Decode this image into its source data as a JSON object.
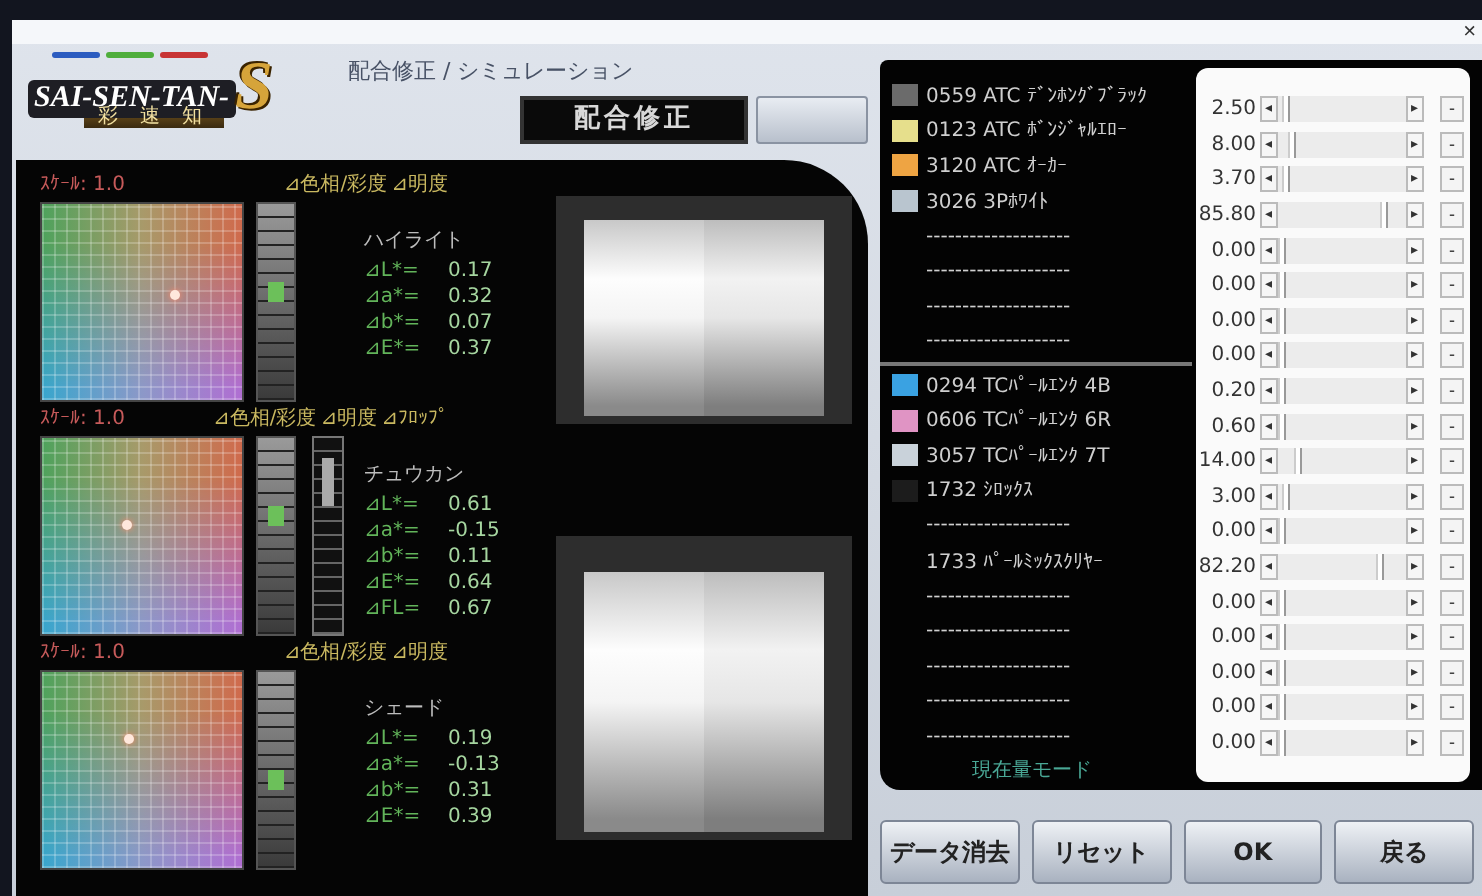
{
  "window": {
    "close": "×"
  },
  "header": {
    "logo": "SAI-SEN-TAN-",
    "logo_mark": "S",
    "logo_sub": "彩 速 知",
    "title": "配合修正 / シミュレーション",
    "mode": "配合修正"
  },
  "analysis": [
    {
      "scale": "ｽｹｰﾙ: 1.0",
      "labels": [
        "⊿色相/彩度",
        "⊿明度"
      ],
      "name": "ハイライト",
      "lightness": {
        "level": 0.55
      },
      "metrics": [
        {
          "label": "⊿L*=",
          "value": "0.17"
        },
        {
          "label": "⊿a*=",
          "value": "0.32"
        },
        {
          "label": "⊿b*=",
          "value": "0.07"
        },
        {
          "label": "⊿E*=",
          "value": "0.37"
        }
      ]
    },
    {
      "scale": "ｽｹｰﾙ: 1.0",
      "labels": [
        "⊿色相/彩度",
        "⊿明度",
        "⊿ﾌﾛｯﾌﾟ"
      ],
      "name": "チュウカン",
      "lightness": {
        "level": 0.6
      },
      "flop": {
        "level": 0.78
      },
      "metrics": [
        {
          "label": "⊿L*=",
          "value": "0.61"
        },
        {
          "label": "⊿a*=",
          "value": "-0.15"
        },
        {
          "label": "⊿b*=",
          "value": "0.11"
        },
        {
          "label": "⊿E*=",
          "value": "0.64"
        },
        {
          "label": "⊿FL=",
          "value": "0.67"
        }
      ]
    },
    {
      "scale": "ｽｹｰﾙ: 1.0",
      "labels": [
        "⊿色相/彩度",
        "⊿明度"
      ],
      "name": "シェード",
      "lightness": {
        "level": 0.45
      },
      "metrics": [
        {
          "label": "⊿L*=",
          "value": "0.19"
        },
        {
          "label": "⊿a*=",
          "value": "-0.13"
        },
        {
          "label": "⊿b*=",
          "value": "0.31"
        },
        {
          "label": "⊿E*=",
          "value": "0.39"
        }
      ]
    }
  ],
  "material_groups": [
    [
      {
        "name": "0559 ATC ﾃﾞﾝﾎﾝｸﾞﾌﾞﾗｯｸ",
        "color": "#6b6b6b"
      },
      {
        "name": "0123 ATC ﾎﾞﾝｼﾞｬﾙｴﾛｰ",
        "color": "#e6df8c"
      },
      {
        "name": "3120 ATC ｵｰｶｰ",
        "color": "#eea443"
      },
      {
        "name": "3026 3Pﾎﾜｲﾄ",
        "color": "#b9c5cf"
      },
      {
        "name": "--------------------"
      },
      {
        "name": "--------------------"
      },
      {
        "name": "--------------------"
      },
      {
        "name": "--------------------"
      }
    ],
    [
      {
        "name": "0294 TCﾊﾟｰﾙｴﾝｸ 4B",
        "color": "#3aa2e2"
      },
      {
        "name": "0606 TCﾊﾟｰﾙｴﾝｸ 6R",
        "color": "#e094c4"
      },
      {
        "name": "3057 TCﾊﾟｰﾙｴﾝｸ 7T",
        "color": "#c9d2da"
      },
      {
        "name": "1732 ｼﾛｯｸｽ",
        "color": "#1c1c1c"
      },
      {
        "name": "--------------------"
      },
      {
        "name": "1733 ﾊﾟｰﾙﾐｯｸｽｸﾘﾔｰ"
      },
      {
        "name": "--------------------"
      },
      {
        "name": "--------------------"
      },
      {
        "name": "--------------------"
      },
      {
        "name": "--------------------"
      },
      {
        "name": "--------------------"
      }
    ]
  ],
  "list_mode": "現在量モード",
  "amounts": [
    {
      "value": "2.50",
      "level": 0.025
    },
    {
      "value": "8.00",
      "level": 0.08
    },
    {
      "value": "3.70",
      "level": 0.037
    },
    {
      "value": "85.80",
      "level": 0.858
    },
    {
      "value": "0.00",
      "level": 0
    },
    {
      "value": "0.00",
      "level": 0
    },
    {
      "value": "0.00",
      "level": 0
    },
    {
      "value": "0.00",
      "level": 0
    },
    {
      "value": "0.20",
      "level": 0.002
    },
    {
      "value": "0.60",
      "level": 0.006
    },
    {
      "value": "14.00",
      "level": 0.14
    },
    {
      "value": "3.00",
      "level": 0.03
    },
    {
      "value": "0.00",
      "level": 0
    },
    {
      "value": "82.20",
      "level": 0.822
    },
    {
      "value": "0.00",
      "level": 0
    },
    {
      "value": "0.00",
      "level": 0
    },
    {
      "value": "0.00",
      "level": 0
    },
    {
      "value": "0.00",
      "level": 0
    },
    {
      "value": "0.00",
      "level": 0
    }
  ],
  "arrows": {
    "left": "◂",
    "right": "▸",
    "minus": "-"
  },
  "buttons": [
    "データ消去",
    "リセット",
    "OK",
    "戻る"
  ]
}
